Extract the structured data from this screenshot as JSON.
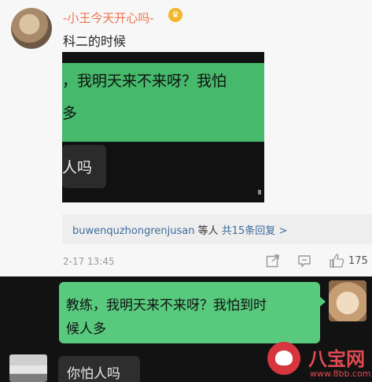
{
  "post": {
    "username": "-小王今天开心吗-",
    "badge_icon": "crown-icon",
    "comment": "科二的时候",
    "photo": {
      "line1": "，我明天来不来呀？我怕",
      "line2": "多",
      "line3": "人吗"
    },
    "replies": {
      "user": "buwenquzhongrenjusan",
      "mid": " 等人 ",
      "count": "共15条回复 >"
    },
    "time": "2-17 13:45",
    "likes": "175"
  },
  "chat": {
    "outgoing": {
      "line1": "教练，我明天来不来呀？我怕到时",
      "line2": "候人多"
    },
    "incoming": {
      "text": "你怕人吗"
    }
  },
  "watermark": {
    "name": "八宝网",
    "url": "www.8bb.com"
  },
  "colors": {
    "accent_orange": "#eb7350",
    "link_blue": "#3f6b9e",
    "chat_green": "#58c97d"
  }
}
